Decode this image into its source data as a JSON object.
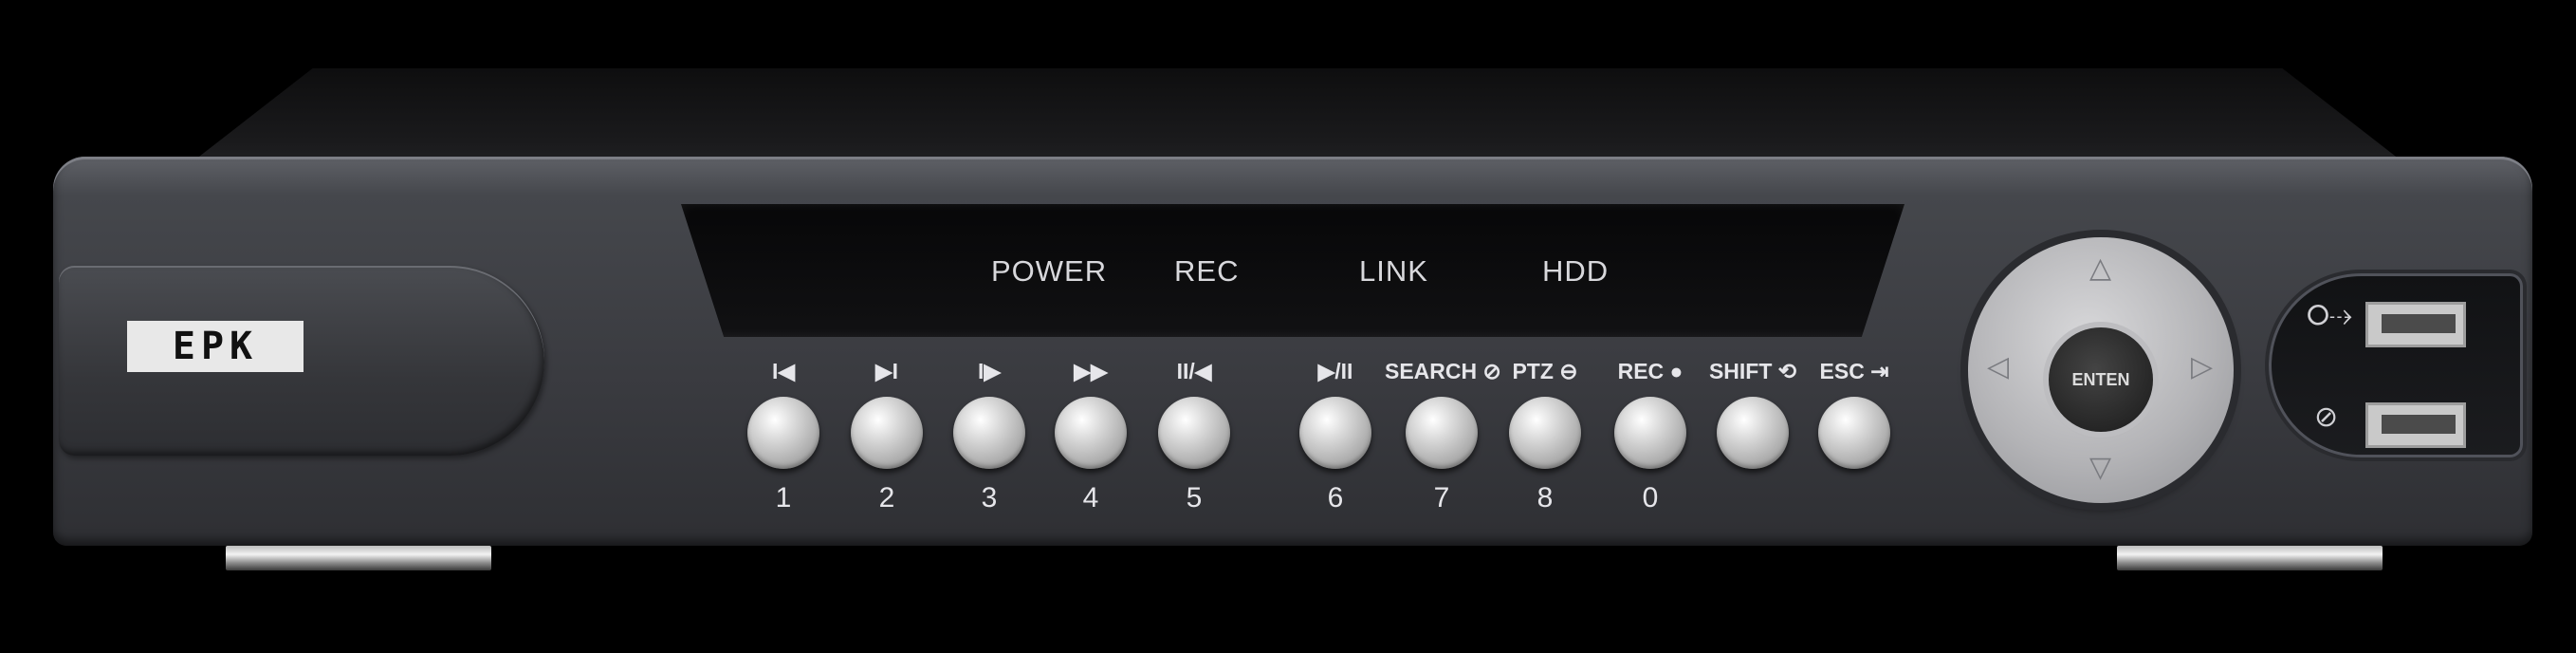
{
  "device": {
    "brand_logo": "EPK"
  },
  "indicators": [
    {
      "label": "POWER"
    },
    {
      "label": "REC"
    },
    {
      "label": "LINK"
    },
    {
      "label": "HDD"
    }
  ],
  "buttons": [
    {
      "function_label": "I◀",
      "number": "1"
    },
    {
      "function_label": "▶I",
      "number": "2"
    },
    {
      "function_label": "I▶",
      "number": "3"
    },
    {
      "function_label": "▶▶",
      "number": "4"
    },
    {
      "function_label": "II/◀",
      "number": "5"
    },
    {
      "function_label": "▶/II",
      "number": "6"
    },
    {
      "function_label": "SEARCH ⊘",
      "number": "7"
    },
    {
      "function_label": "PTZ ⊖",
      "number": "8"
    },
    {
      "function_label": "REC ●",
      "number": "0"
    },
    {
      "function_label": "SHIFT ⟲",
      "number": ""
    },
    {
      "function_label": "ESC ⇥",
      "number": ""
    }
  ],
  "nav": {
    "enter_label": "ENTEN",
    "up_icon": "up-arrow",
    "down_icon": "down-arrow",
    "left_icon": "left-arrow",
    "right_icon": "right-arrow"
  },
  "usb": {
    "icons": [
      "usb-icon",
      "mouse-icon"
    ]
  },
  "colors": {
    "chassis": "#3a3b40",
    "button": "#d9d9d9",
    "text": "#e6e6ea"
  }
}
